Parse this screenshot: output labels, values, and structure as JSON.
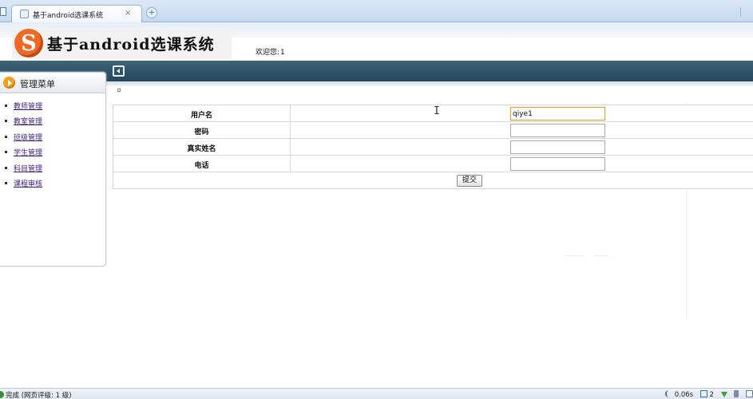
{
  "browser": {
    "tab_title": "基于android选课系统",
    "tab_close": "×",
    "new_tab": "+"
  },
  "header": {
    "logo_letter": "S",
    "system_title": "基于android选课系统",
    "welcome_label": "欢迎您:",
    "username": "1"
  },
  "sidebar": {
    "title": "管理菜单",
    "items": [
      {
        "label": "教师管理"
      },
      {
        "label": "教室管理"
      },
      {
        "label": "班级管理"
      },
      {
        "label": "学生管理"
      },
      {
        "label": "科目管理"
      },
      {
        "label": "课程审核"
      }
    ]
  },
  "form": {
    "fields": [
      {
        "label": "用户名",
        "value": "qiye1"
      },
      {
        "label": "密码",
        "value": ""
      },
      {
        "label": "真实姓名",
        "value": ""
      },
      {
        "label": "电话",
        "value": ""
      }
    ],
    "submit_label": "提交"
  },
  "statusbar": {
    "left_text": "完成 (网页评级: 1 级)",
    "load_time": "0.06s",
    "window_count": "2"
  },
  "colors": {
    "navbar": "#2e5366",
    "logo_orange": "#ee6a24",
    "sidebar_icon": "#f1a21d",
    "link": "#3b1f80",
    "input_focus": "#e5a33b"
  },
  "icons": [
    "page-favicon",
    "close-icon",
    "add-tab-icon",
    "logo-icon",
    "collapse-sidebar-icon",
    "arrow-right-circle-icon",
    "page-loaded-icon",
    "speed-icon",
    "window-icon",
    "download-icon",
    "sound-icon",
    "grid-icon"
  ]
}
